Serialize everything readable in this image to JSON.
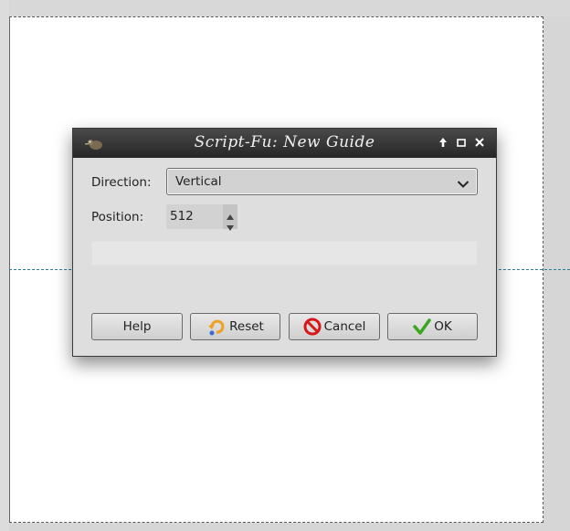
{
  "canvas": {
    "guide_color": "#2a7a9a"
  },
  "dialog": {
    "title": "Script-Fu: New Guide",
    "window_buttons": {
      "up_icon": "arrow-up-icon",
      "maximize_icon": "maximize-icon",
      "close_icon": "close-icon"
    },
    "direction": {
      "label": "Direction:",
      "value": "Vertical"
    },
    "position": {
      "label": "Position:",
      "value": "512"
    },
    "progress": {
      "fraction": 0
    },
    "buttons": {
      "help": "Help",
      "reset": "Reset",
      "cancel": "Cancel",
      "ok": "OK"
    },
    "colors": {
      "titlebar": "#2e2e2e",
      "body": "#dedede",
      "cancel_icon": "#d81818",
      "ok_icon": "#3aa620",
      "reset_icon": "#f0a020"
    }
  }
}
